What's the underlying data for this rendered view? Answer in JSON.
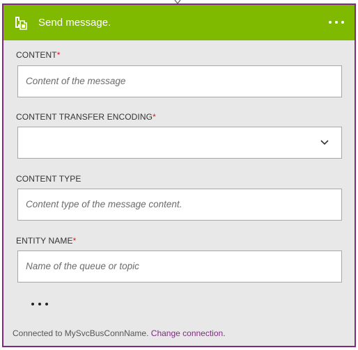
{
  "header": {
    "title": "Send message.",
    "icon": "service-bus-icon",
    "more": "more-options-icon",
    "accent_color": "#7fba00",
    "border_color": "#7e2b7e"
  },
  "fields": [
    {
      "label": "CONTENT",
      "required": "*",
      "placeholder": "Content of the message",
      "value": ""
    },
    {
      "label": "CONTENT TRANSFER ENCODING",
      "required": "*",
      "placeholder": "",
      "value": ""
    },
    {
      "label": "CONTENT TYPE",
      "required": "",
      "placeholder": "Content type of the message content.",
      "value": ""
    },
    {
      "label": "ENTITY NAME",
      "required": "*",
      "placeholder": "Name of the queue or topic",
      "value": ""
    }
  ],
  "more_params": "...",
  "footer": {
    "connected_text": "Connected to MySvcBusConnName.",
    "change_link": "Change connection."
  }
}
